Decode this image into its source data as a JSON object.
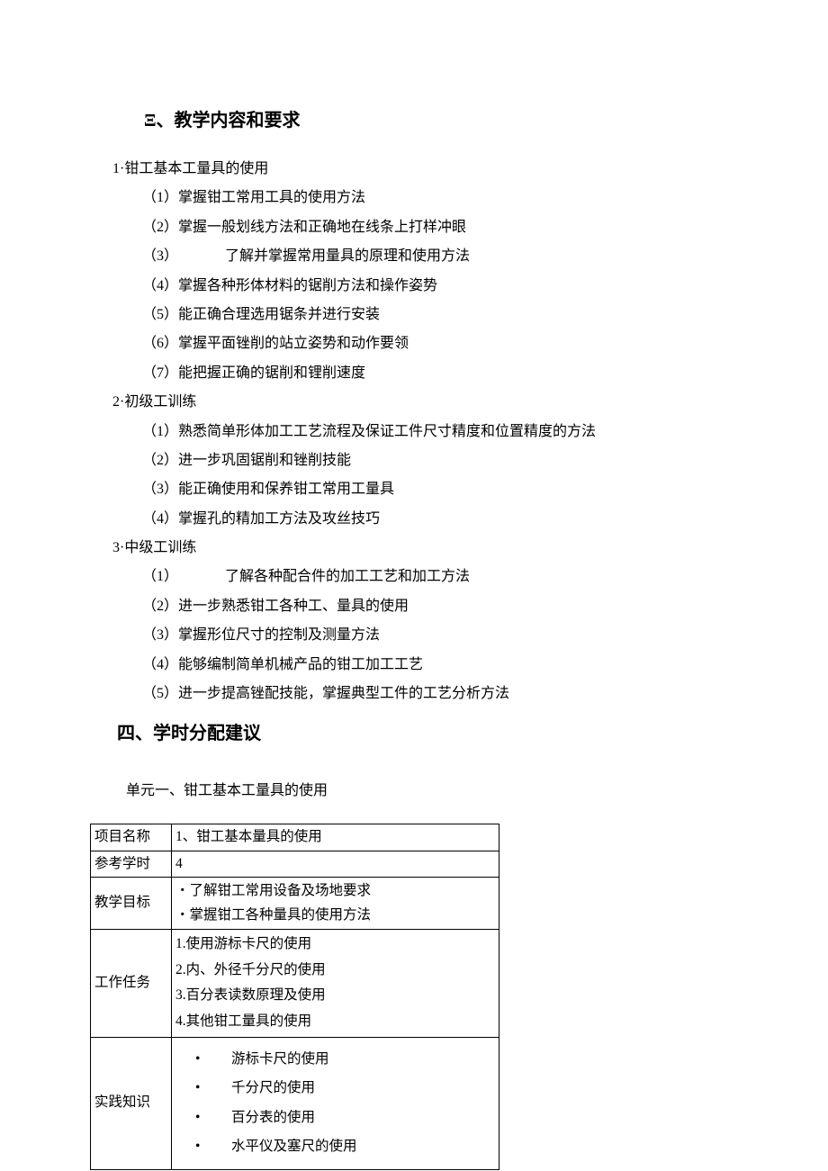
{
  "section3": {
    "heading": "Ξ、教学内容和要求",
    "item1": {
      "title": "1·钳工基本工量具的使用",
      "s1": "（1）掌握钳工常用工具的使用方法",
      "s2": "（2）掌握一般划线方法和正确地在线条上打样冲眼",
      "s3_prefix": "（3）",
      "s3_body": "了解并掌握常用量具的原理和使用方法",
      "s4": "（4）掌握各种形体材料的锯削方法和操作姿势",
      "s5": "（5）能正确合理选用锯条并进行安装",
      "s6": "（6）掌握平面锉削的站立姿势和动作要领",
      "s7": "（7）能把握正确的锯削和锂削速度"
    },
    "item2": {
      "title": "2·初级工训练",
      "s1": "（1）熟悉简单形体加工工艺流程及保证工件尺寸精度和位置精度的方法",
      "s2": "（2）进一步巩固锯削和锉削技能",
      "s3": "（3）能正确使用和保养钳工常用工量具",
      "s4": "（4）掌握孔的精加工方法及攻丝技巧"
    },
    "item3": {
      "title": "3·中级工训练",
      "s1_prefix": "（1）",
      "s1_body": "了解各种配合件的加工工艺和加工方法",
      "s2": "（2）进一步熟悉钳工各种工、量具的使用",
      "s3": "（3）掌握形位尺寸的控制及测量方法",
      "s4": "（4）能够编制简单机械产品的钳工加工工艺",
      "s5": "（5）进一步提高锉配技能，掌握典型工件的工艺分析方法"
    }
  },
  "section4": {
    "heading": "四、学时分配建议",
    "unit_title": "单元一、钳工基本工量具的使用",
    "table": {
      "row1": {
        "label": "项目名称",
        "value": "1、钳工基本量具的使用"
      },
      "row2": {
        "label": "参考学时",
        "value": "4"
      },
      "row3": {
        "label": "教学目标",
        "g1": "・了解钳工常用设备及场地要求",
        "g2": "・掌握钳工各种量具的使用方法"
      },
      "row4": {
        "label": "工作任务",
        "t1": "1.使用游标卡尺的使用",
        "t2": "2.内、外径千分尺的使用",
        "t3": "3.百分表读数原理及使用",
        "t4": "4.其他钳工量具的使用"
      },
      "row5": {
        "label": "实践知识",
        "p1": "游标卡尺的使用",
        "p2": "千分尺的使用",
        "p3": "百分表的使用",
        "p4": "水平仪及塞尺的使用"
      }
    }
  }
}
